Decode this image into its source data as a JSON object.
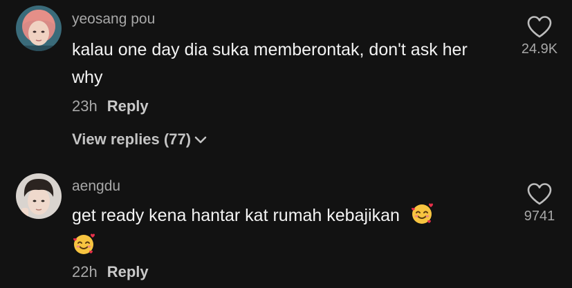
{
  "comments": [
    {
      "username": "yeosang pou",
      "text": "kalau one day dia suka memberontak, don't ask her why",
      "time": "23h",
      "reply_label": "Reply",
      "like_count": "24.9K",
      "view_replies_label": "View replies (77)",
      "avatar_icon": "avatar-pink-hair-user",
      "heart_icon": "heart-outline-icon",
      "chevron_icon": "chevron-down-icon"
    },
    {
      "username": "aengdu",
      "text": "get ready kena hantar kat rumah kebajikan",
      "time": "22h",
      "reply_label": "Reply",
      "like_count": "9741",
      "avatar_icon": "avatar-dark-hair-user",
      "heart_icon": "heart-outline-icon",
      "emoji_icon": "smiling-face-with-hearts-emoji"
    }
  ],
  "colors": {
    "background": "#121212",
    "primary_text": "#f3f3f3",
    "secondary_text": "#a8a8a8"
  }
}
